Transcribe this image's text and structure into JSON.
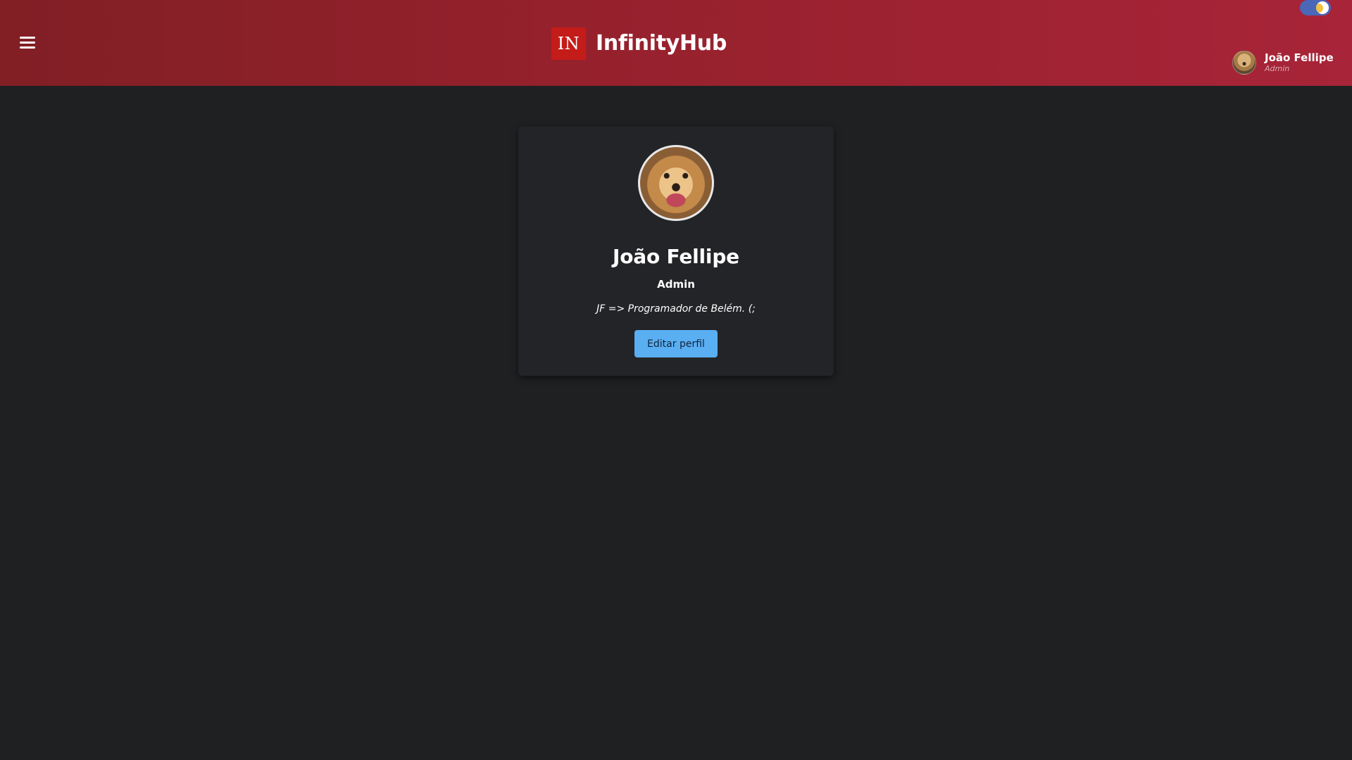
{
  "header": {
    "menu_icon": "hamburger-menu-icon",
    "brand": {
      "logo_text": "IN",
      "name": "InfinityHub",
      "logo_color": "#c41c19"
    },
    "theme_toggle": {
      "icon": "moon-icon",
      "state": "dark",
      "color": "#4a67b8"
    },
    "user": {
      "name": "João Fellipe",
      "role": "Admin"
    },
    "gradient": [
      "#811f25",
      "#a82438"
    ]
  },
  "profile": {
    "name": "João Fellipe",
    "role": "Admin",
    "bio": "JF => Programador de Belém. (;",
    "edit_label": "Editar perfil",
    "button_color": "#5aaef2"
  },
  "background_color": "#1f2022"
}
